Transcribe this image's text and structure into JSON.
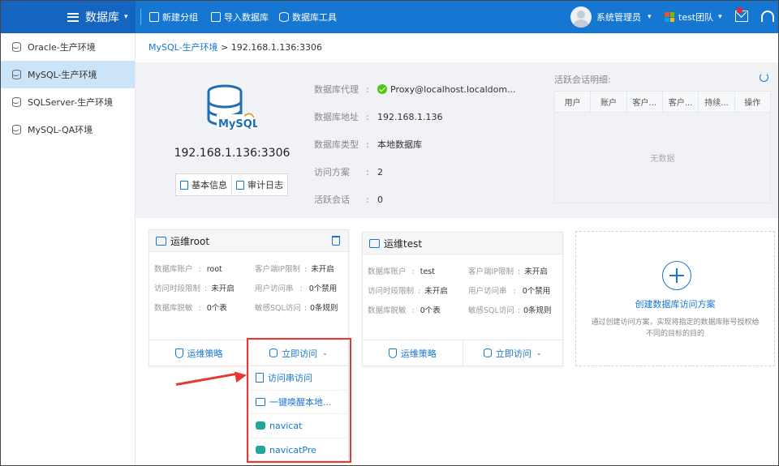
{
  "topbar": {
    "module_title": "数据库",
    "actions": [
      {
        "label": "新建分组",
        "icon": "add-group-icon"
      },
      {
        "label": "导入数据库",
        "icon": "import-icon"
      },
      {
        "label": "数据库工具",
        "icon": "db-tools-icon"
      }
    ],
    "user_name": "系统管理员",
    "team_name": "test团队",
    "colors": {
      "bar": "#1677d2",
      "brand": "#1565c0",
      "logo": [
        "#f25022",
        "#7fba00",
        "#00a4ef",
        "#ffb900"
      ]
    }
  },
  "sidebar": {
    "items": [
      {
        "label": "Oracle-生产环境",
        "active": false
      },
      {
        "label": "MySQL-生产环境",
        "active": true
      },
      {
        "label": "SQLServer-生产环境",
        "active": false
      },
      {
        "label": "MySQL-QA环境",
        "active": false
      }
    ]
  },
  "breadcrumb": {
    "parent": "MySQL-生产环境",
    "separator": ">",
    "current": "192.168.1.136:3306"
  },
  "database": {
    "logo_text": "MySQL",
    "host": "192.168.1.136:3306",
    "tabs": [
      "基本信息",
      "审计日志"
    ],
    "props": [
      {
        "key": "数据库代理",
        "value": "Proxy@localhost.localdom...",
        "status": "ok"
      },
      {
        "key": "数据库地址",
        "value": "192.168.1.136"
      },
      {
        "key": "数据库类型",
        "value": "本地数据库"
      },
      {
        "key": "访问方案",
        "value": "2"
      },
      {
        "key": "活跃会话",
        "value": "0"
      }
    ],
    "prop_separator": ":"
  },
  "sessions": {
    "title": "活跃会话明细:",
    "columns": [
      "用户",
      "账户",
      "客户...",
      "客户...",
      "持续...",
      "操作"
    ],
    "empty_text": "无数据"
  },
  "cards": [
    {
      "title": "运维root",
      "fields": [
        {
          "key": "数据库账户",
          "value": "root"
        },
        {
          "key": "客户端IP限制",
          "value": "未开启"
        },
        {
          "key": "访问时段限制",
          "value": "未开启"
        },
        {
          "key": "用户访问串",
          "value": "0个禁用"
        },
        {
          "key": "数据库脱敏",
          "value": "0个表"
        },
        {
          "key": "敏感SQL访问",
          "value": "0条规则"
        }
      ],
      "policy_label": "运维策略",
      "access_label": "立即访问"
    },
    {
      "title": "运维test",
      "fields": [
        {
          "key": "数据库账户",
          "value": "test"
        },
        {
          "key": "客户端IP限制",
          "value": "未开启"
        },
        {
          "key": "访问时段限制",
          "value": "未开启"
        },
        {
          "key": "用户访问串",
          "value": "0个禁用"
        },
        {
          "key": "数据库脱敏",
          "value": "0个表"
        },
        {
          "key": "敏感SQL访问",
          "value": "0条规则"
        }
      ],
      "policy_label": "运维策略",
      "access_label": "立即访问"
    }
  ],
  "field_separator": ":",
  "create_card": {
    "title": "创建数据库访问方案",
    "description": "通过创建访问方案，实现将指定的数据库账号授权给不同的目标的目的"
  },
  "dropdown": {
    "items": [
      {
        "label": "访问串访问",
        "icon": "document-icon"
      },
      {
        "label": "一键唤醒本地...",
        "icon": "monitor-icon"
      },
      {
        "label": "navicat",
        "icon": "navicat-icon"
      },
      {
        "label": "navicatPre",
        "icon": "navicat-icon"
      }
    ]
  },
  "annotation": {
    "color": "#e53935"
  }
}
